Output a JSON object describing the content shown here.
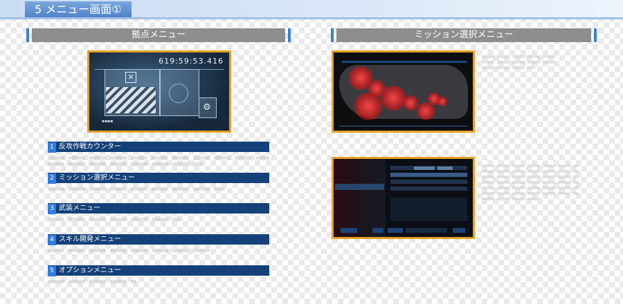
{
  "page": {
    "title": "5 メニュー画面①"
  },
  "left_section": {
    "header": "拠点メニュー",
    "screenshot": {
      "timer": "619:59:53.416"
    },
    "menu_items": [
      {
        "number": "1",
        "label": "反攻作戦カウンター"
      },
      {
        "number": "2",
        "label": "ミッション選択メニュー"
      },
      {
        "number": "3",
        "label": "武装メニュー"
      },
      {
        "number": "4",
        "label": "スキル開発メニュー"
      },
      {
        "number": "5",
        "label": "オプションメニュー"
      }
    ]
  },
  "right_section": {
    "header": "ミッション選択メニュー"
  },
  "colors": {
    "accent": "#3a7fd5",
    "menu_bar": "#144179",
    "number_badge": "#2f7be0",
    "screenshot_border": "#e3a126",
    "header_bar": "#8e8e8e"
  },
  "icons": [
    "base-emblem-icon",
    "gear-icon"
  ]
}
